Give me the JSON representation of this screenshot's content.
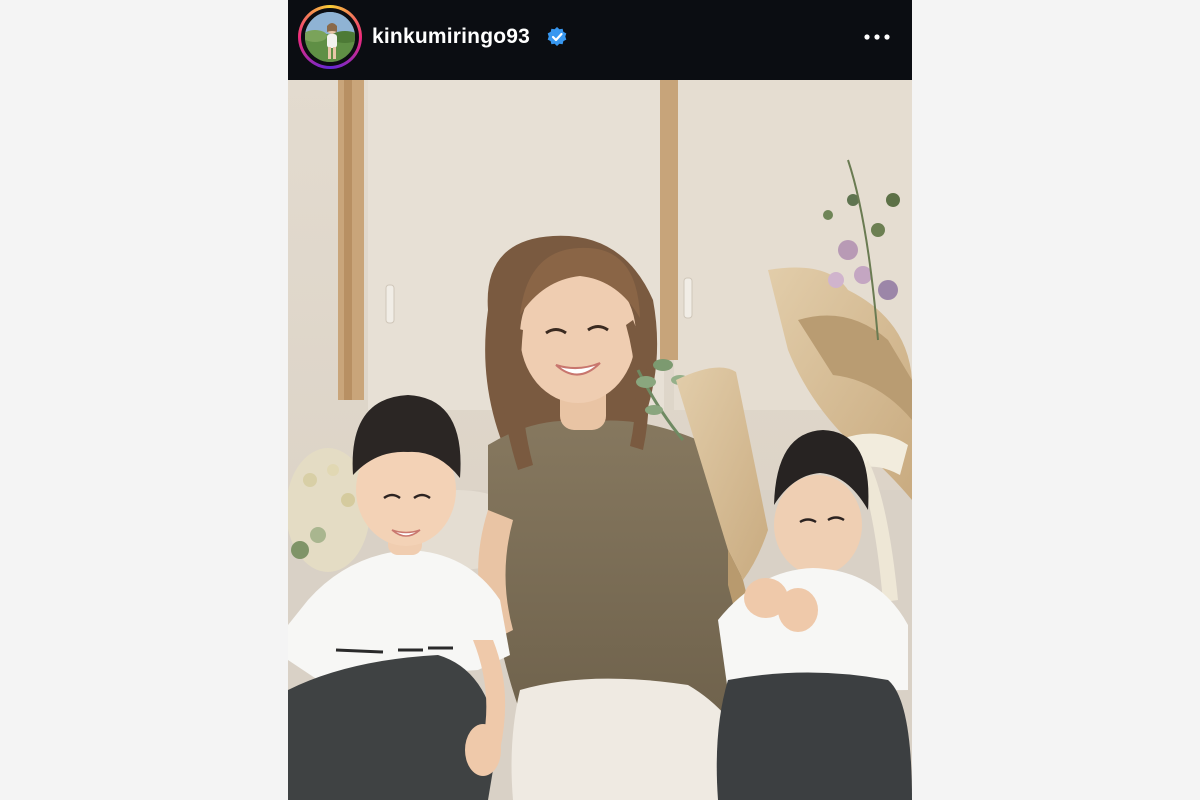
{
  "post": {
    "username": "kinkumiringo93",
    "verified": true,
    "icons": {
      "verified": "verified-badge-icon",
      "more": "more-options-icon"
    },
    "colors": {
      "header_bg": "#0b0d12",
      "verified_blue": "#3897f0",
      "story_ring_start": "#f9ce34",
      "story_ring_mid": "#ee2a7b",
      "story_ring_end": "#6228d7"
    }
  }
}
